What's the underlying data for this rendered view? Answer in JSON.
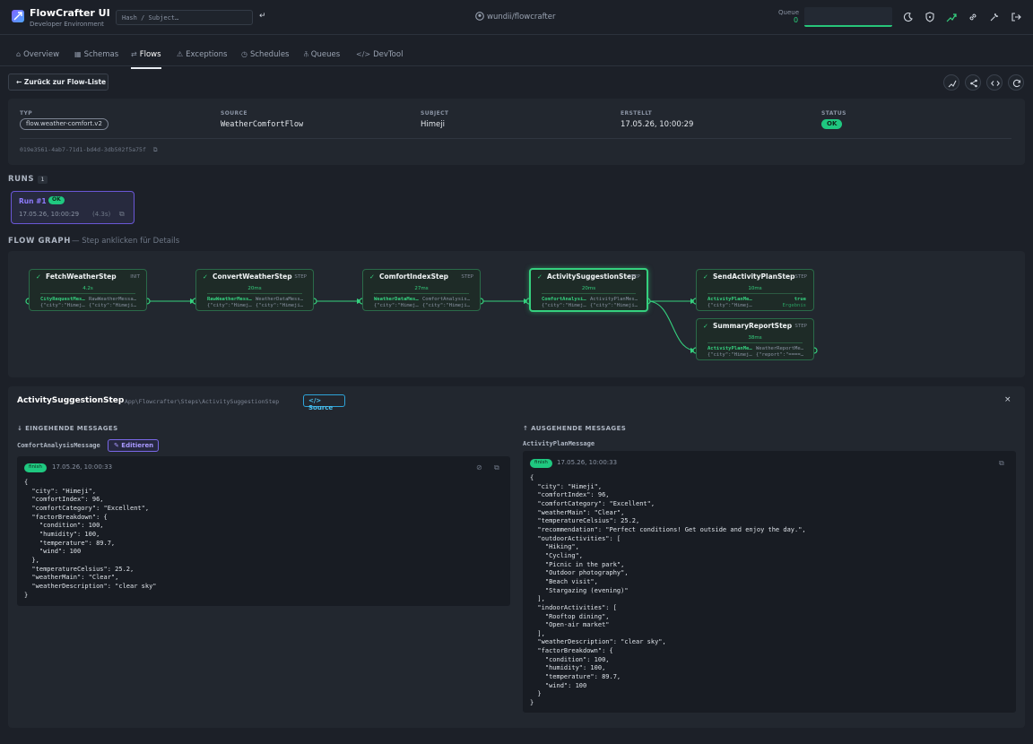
{
  "header": {
    "app_title": "FlowCrafter UI",
    "app_subtitle": "Developer Environment",
    "search_placeholder": "Hash / Subject…",
    "enter_glyph": "↵",
    "repo": "wundii/flowcrafter",
    "queue_label": "Queue",
    "queue_count": "0"
  },
  "tabs": [
    {
      "label": "Overview",
      "icon": "⌂"
    },
    {
      "label": "Schemas",
      "icon": "▦"
    },
    {
      "label": "Flows",
      "icon": "⇄"
    },
    {
      "label": "Exceptions",
      "icon": "⚠"
    },
    {
      "label": "Schedules",
      "icon": "◷"
    },
    {
      "label": "Queues",
      "icon": "⫚"
    },
    {
      "label": "DevTool",
      "icon": "</>"
    }
  ],
  "back_button": "← Zurück zur Flow-Liste",
  "info": {
    "type_label": "TYP",
    "type_value": "flow.weather-comfort.v2",
    "source_label": "SOURCE",
    "source_value": "WeatherComfortFlow",
    "subject_label": "SUBJECT",
    "subject_value": "Himeji",
    "created_label": "ERSTELLT",
    "created_value": "17.05.26, 10:00:29",
    "status_label": "STATUS",
    "status_value": "OK",
    "uuid": "019e3561-4ab7-71d1-bd4d-3db502f5a75f"
  },
  "runs": {
    "title": "RUNS",
    "count": "1",
    "run_title": "Run #1",
    "run_status": "OK",
    "run_date": "17.05.26, 10:00:29",
    "run_duration": "(4.3s)"
  },
  "graph": {
    "title": "FLOW GRAPH",
    "subtitle": "— Step anklicken für Details",
    "nodes": [
      {
        "name": "FetchWeatherStep",
        "tag": "INIT",
        "duration": "4.2s",
        "in_msg": "CityRequestMessage",
        "in_payload": "{\"city\":\"Himeji\"}",
        "out_msg": "RawWeatherMessage",
        "out_payload": "{\"city\":\"Himeji\",\"t"
      },
      {
        "name": "ConvertWeatherStep",
        "tag": "STEP",
        "duration": "20ms",
        "in_msg": "RawWeatherMessage",
        "in_payload": "{\"city\":\"Himeji\"",
        "out_msg": "WeatherDataMessage",
        "out_payload": "{\"city\":\"Himeji\",\"t"
      },
      {
        "name": "ComfortIndexStep",
        "tag": "STEP",
        "duration": "27ms",
        "in_msg": "WeatherDataMessage",
        "in_payload": "{\"city\":\"Himeji\"",
        "out_msg": "ComfortAnalysisMessage",
        "out_payload": "{\"city\":\"Himeji\",\"c"
      },
      {
        "name": "ActivitySuggestionStep",
        "tag": "STEP",
        "duration": "20ms",
        "in_msg": "ComfortAnalysisMessage",
        "in_payload": "{\"city\":\"Himeji\"",
        "out_msg": "ActivityPlanMessage",
        "out_payload": "{\"city\":\"Himeji\",\"c"
      },
      {
        "name": "SendActivityPlanStep",
        "tag": "STEP",
        "duration": "10ms",
        "in_msg": "ActivityPlanMessage",
        "in_payload": "{\"city\":\"Himeji\"",
        "out_msg": "true",
        "out_payload": "Ergebnis"
      },
      {
        "name": "SummaryReportStep",
        "tag": "STEP",
        "duration": "38ms",
        "in_msg": "ActivityPlanMessage",
        "in_payload": "{\"city\":\"Himeji\"",
        "out_msg": "WeatherReportMessage",
        "out_payload": "{\"report\":\"======"
      }
    ]
  },
  "detail": {
    "title": "ActivitySuggestionStep",
    "path": "App\\Flowcrafter\\Steps\\ActivitySuggestionStep",
    "source_button": "</> Source",
    "close": "×",
    "incoming_title": "↓ EINGEHENDE MESSAGES",
    "incoming_name": "ComfortAnalysisMessage",
    "edit_button": "✎ Editieren",
    "incoming_status": "finish",
    "incoming_date": "17.05.26, 10:00:33",
    "incoming_json": "{\n  \"city\": \"Himeji\",\n  \"comfortIndex\": 96,\n  \"comfortCategory\": \"Excellent\",\n  \"factorBreakdown\": {\n    \"condition\": 100,\n    \"humidity\": 100,\n    \"temperature\": 89.7,\n    \"wind\": 100\n  },\n  \"temperatureCelsius\": 25.2,\n  \"weatherMain\": \"Clear\",\n  \"weatherDescription\": \"clear sky\"\n}",
    "outgoing_title": "↑ AUSGEHENDE MESSAGES",
    "outgoing_name": "ActivityPlanMessage",
    "outgoing_status": "finish",
    "outgoing_date": "17.05.26, 10:00:33",
    "outgoing_json": "{\n  \"city\": \"Himeji\",\n  \"comfortIndex\": 96,\n  \"comfortCategory\": \"Excellent\",\n  \"weatherMain\": \"Clear\",\n  \"temperatureCelsius\": 25.2,\n  \"recommendation\": \"Perfect conditions! Get outside and enjoy the day.\",\n  \"outdoorActivities\": [\n    \"Hiking\",\n    \"Cycling\",\n    \"Picnic in the park\",\n    \"Outdoor photography\",\n    \"Beach visit\",\n    \"Stargazing (evening)\"\n  ],\n  \"indoorActivities\": [\n    \"Rooftop dining\",\n    \"Open-air market\"\n  ],\n  \"weatherDescription\": \"clear sky\",\n  \"factorBreakdown\": {\n    \"condition\": 100,\n    \"humidity\": 100,\n    \"temperature\": 89.7,\n    \"wind\": 100\n  }\n}"
  },
  "colors": {
    "background": "#1c2028",
    "card": "#22272f",
    "accent_green": "#35d07e",
    "accent_purple": "#8f7cff",
    "accent_blue": "#4cc1ef"
  }
}
